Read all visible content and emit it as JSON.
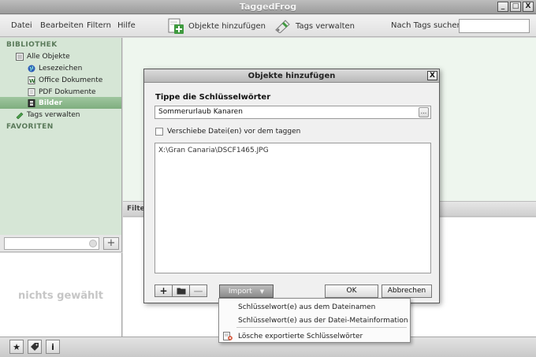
{
  "window": {
    "title": "TaggedFrog",
    "buttons": [
      "_",
      "□",
      "X"
    ]
  },
  "menu": {
    "items": [
      "Datei",
      "Bearbeiten",
      "Filtern",
      "Hilfe"
    ]
  },
  "toolbar": {
    "add_objects": "Objekte hinzufügen",
    "manage_tags": "Tags verwalten",
    "search_label": "Nach Tags suchen",
    "search_value": ""
  },
  "sidebar": {
    "library_heading": "BIBLIOTHEK",
    "items": [
      {
        "label": "Alle Objekte",
        "icon": "list-icon"
      },
      {
        "label": "Lesezeichen",
        "icon": "globe-icon"
      },
      {
        "label": "Office Dokumente",
        "icon": "word-doc-icon"
      },
      {
        "label": "PDF Dokumente",
        "icon": "pdf-doc-icon"
      },
      {
        "label": "Bilder",
        "icon": "film-icon",
        "selected": true
      },
      {
        "label": "Tags verwalten",
        "icon": "tag-pencil-icon"
      }
    ],
    "favorites_heading": "FAVORITEN",
    "plus_label": "+",
    "empty_message": "nichts gewählt"
  },
  "main": {
    "filter_label": "Filter"
  },
  "statusbar": {
    "buttons": [
      "★",
      "⬥",
      "i"
    ]
  },
  "dialog": {
    "title": "Objekte hinzufügen",
    "close": "X",
    "heading": "Tippe die Schlüsselwörter",
    "keyword_value": "Sommerurlaub Kanaren",
    "more_label": "...",
    "move_checkbox_label": "Verschiebe Datei(en) vor dem taggen",
    "files": [
      "X:\\Gran Canaria\\DSCF1465.JPG"
    ],
    "tool_buttons": [
      "+",
      "▬",
      "—"
    ],
    "import_label": "Import",
    "import_arrow": "▼",
    "ok_label": "OK",
    "cancel_label": "Abbrechen"
  },
  "import_menu": {
    "items": [
      "Schlüsselwort(e) aus dem Dateinamen",
      "Schlüsselwort(e) aus der Datei-Metainformation",
      "Lösche exportierte Schlüsselwörter"
    ]
  },
  "colors": {
    "sidebar_bg": "#d6e6d6",
    "selected_bg": "#8fbb8f",
    "add_icon": "#3f9a3f"
  }
}
